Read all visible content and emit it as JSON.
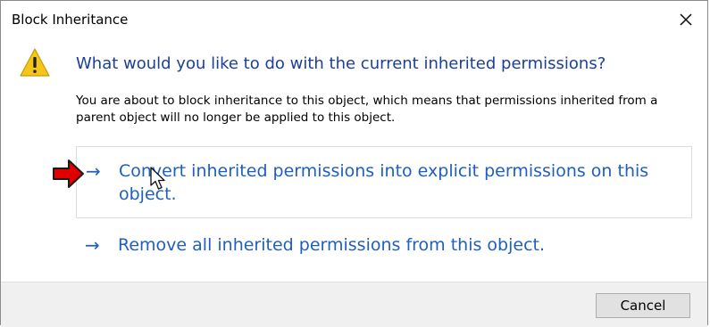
{
  "window": {
    "title": "Block Inheritance"
  },
  "main_instruction": "What would you like to do with the current inherited permissions?",
  "content_text": "You are about to block inheritance to this object, which means that permissions inherited from a parent object will no longer be applied to this object.",
  "command_links": [
    {
      "arrow": "→",
      "label": "Convert inherited permissions into explicit permissions on this object.",
      "selected": true
    },
    {
      "arrow": "→",
      "label": "Remove all inherited permissions from this object.",
      "selected": false
    }
  ],
  "footer": {
    "cancel_label": "Cancel"
  },
  "icons": {
    "warning": "warning-icon",
    "close": "close-icon",
    "annotation_arrow": "red-arrow-icon",
    "cursor": "mouse-cursor-icon"
  },
  "colors": {
    "instruction_blue": "#1c3f9a",
    "link_blue": "#1f5fbf",
    "warning_yellow": "#f5c518",
    "annotation_red": "#e00000",
    "footer_bg": "#f0f0f0"
  }
}
